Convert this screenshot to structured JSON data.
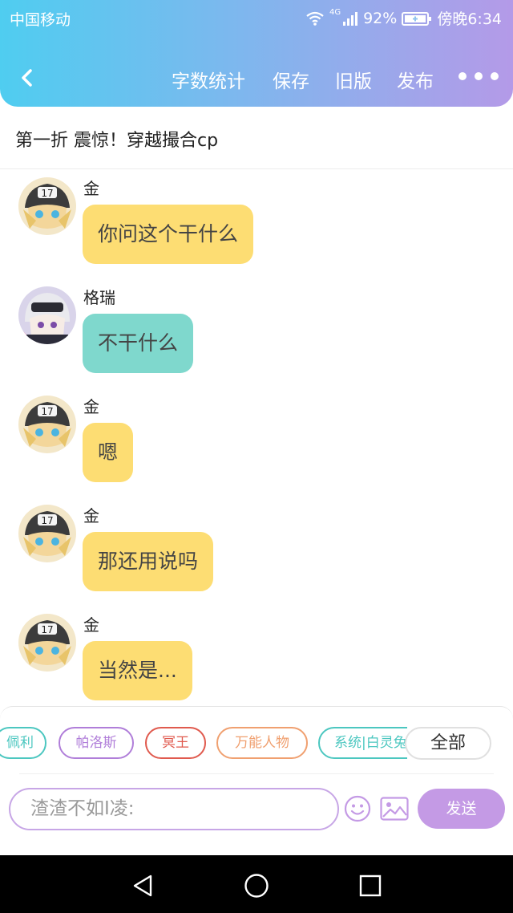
{
  "status_bar": {
    "carrier": "中国移动",
    "network_type": "4G",
    "battery": "92%",
    "time": "傍晚6:34"
  },
  "toolbar": {
    "word_count": "字数统计",
    "save": "保存",
    "old_version": "旧版",
    "publish": "发布"
  },
  "chapter_title": "第一折 震惊！穿越撮合cp",
  "messages": [
    {
      "sender": "金",
      "text": "你问这个干什么",
      "bubble_color": "#fddd73"
    },
    {
      "sender": "格瑞",
      "text": "不干什么",
      "bubble_color": "#7fd8cd"
    },
    {
      "sender": "金",
      "text": "嗯",
      "bubble_color": "#fddd73"
    },
    {
      "sender": "金",
      "text": "那还用说吗",
      "bubble_color": "#fddd73"
    },
    {
      "sender": "金",
      "text": "当然是...",
      "bubble_color": "#fddd73"
    }
  ],
  "characters": [
    {
      "name": "佩利",
      "color": "#4cc7c0"
    },
    {
      "name": "帕洛斯",
      "color": "#b07ed9"
    },
    {
      "name": "冥王",
      "color": "#e05a4e"
    },
    {
      "name": "万能人物",
      "color": "#f0a070"
    },
    {
      "name": "系统|白灵兔",
      "color": "#4cc7c0"
    }
  ],
  "all_label": "全部",
  "input": {
    "placeholder": "渣渣不如I凌:",
    "send_label": "发送"
  },
  "colors": {
    "header_gradient": [
      "#4fcdf0",
      "#b49ae8"
    ],
    "accent": "#c49ae5"
  }
}
